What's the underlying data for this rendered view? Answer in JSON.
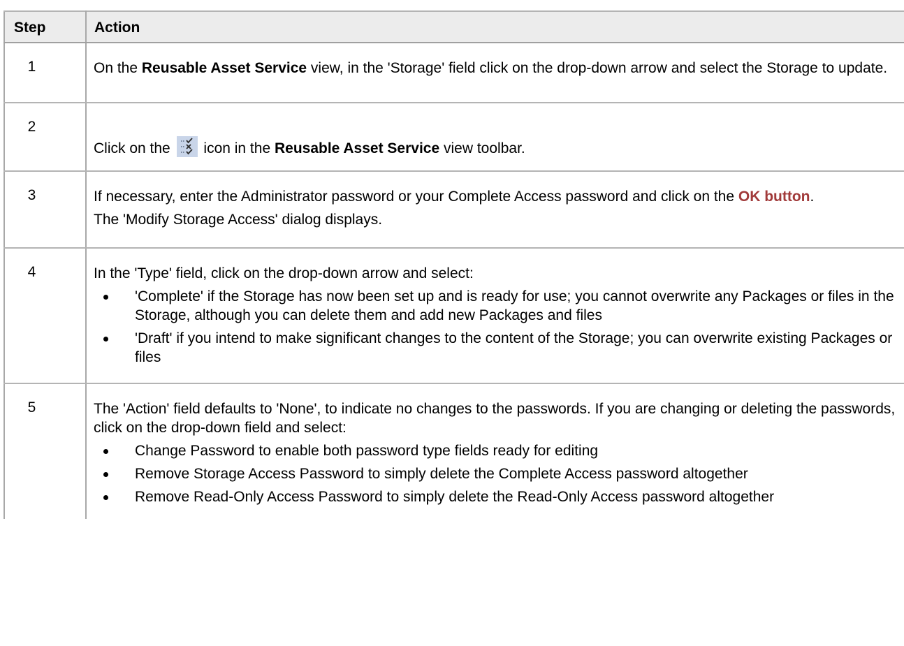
{
  "table": {
    "headers": {
      "step": "Step",
      "action": "Action"
    },
    "rows": [
      {
        "step": "1",
        "text_a": "On the ",
        "bold_a": "Reusable Asset Service",
        "text_b": " view, in the 'Storage' field click on the drop-down arrow and select the Storage to update."
      },
      {
        "step": "2",
        "text_a": "Click on the ",
        "icon": "storage-access-toolbar-icon",
        "text_b": " icon in the ",
        "bold_a": "Reusable Asset Service",
        "text_c": " view toolbar."
      },
      {
        "step": "3",
        "text_a": "If necessary, enter the Administrator password or your Complete Access password and click on the ",
        "link": "OK button",
        "text_b": ".",
        "para2": "The 'Modify Storage Access' dialog displays."
      },
      {
        "step": "4",
        "intro": "In the 'Type' field, click on the drop-down arrow and select:",
        "bullets": [
          "'Complete' if the Storage has now been set up and is ready for use; you cannot overwrite any Packages or files in the Storage, although you can delete them and add new Packages and files",
          "'Draft' if you intend to make significant changes to the content of the Storage; you can overwrite existing Packages or files"
        ]
      },
      {
        "step": "5",
        "intro": "The 'Action' field defaults to 'None', to indicate no changes to the passwords. If you are changing or deleting the passwords, click on the drop-down field and select:",
        "bullets": [
          "Change Password to enable both password type fields ready for editing",
          "Remove Storage Access Password to simply delete the Complete Access password altogether",
          "Remove Read-Only Access Password to simply delete the Read-Only Access password altogether"
        ]
      }
    ]
  },
  "colors": {
    "header_bg": "#ececec",
    "border": "#a8a8a8",
    "ui_reference": "#a13a3a"
  }
}
